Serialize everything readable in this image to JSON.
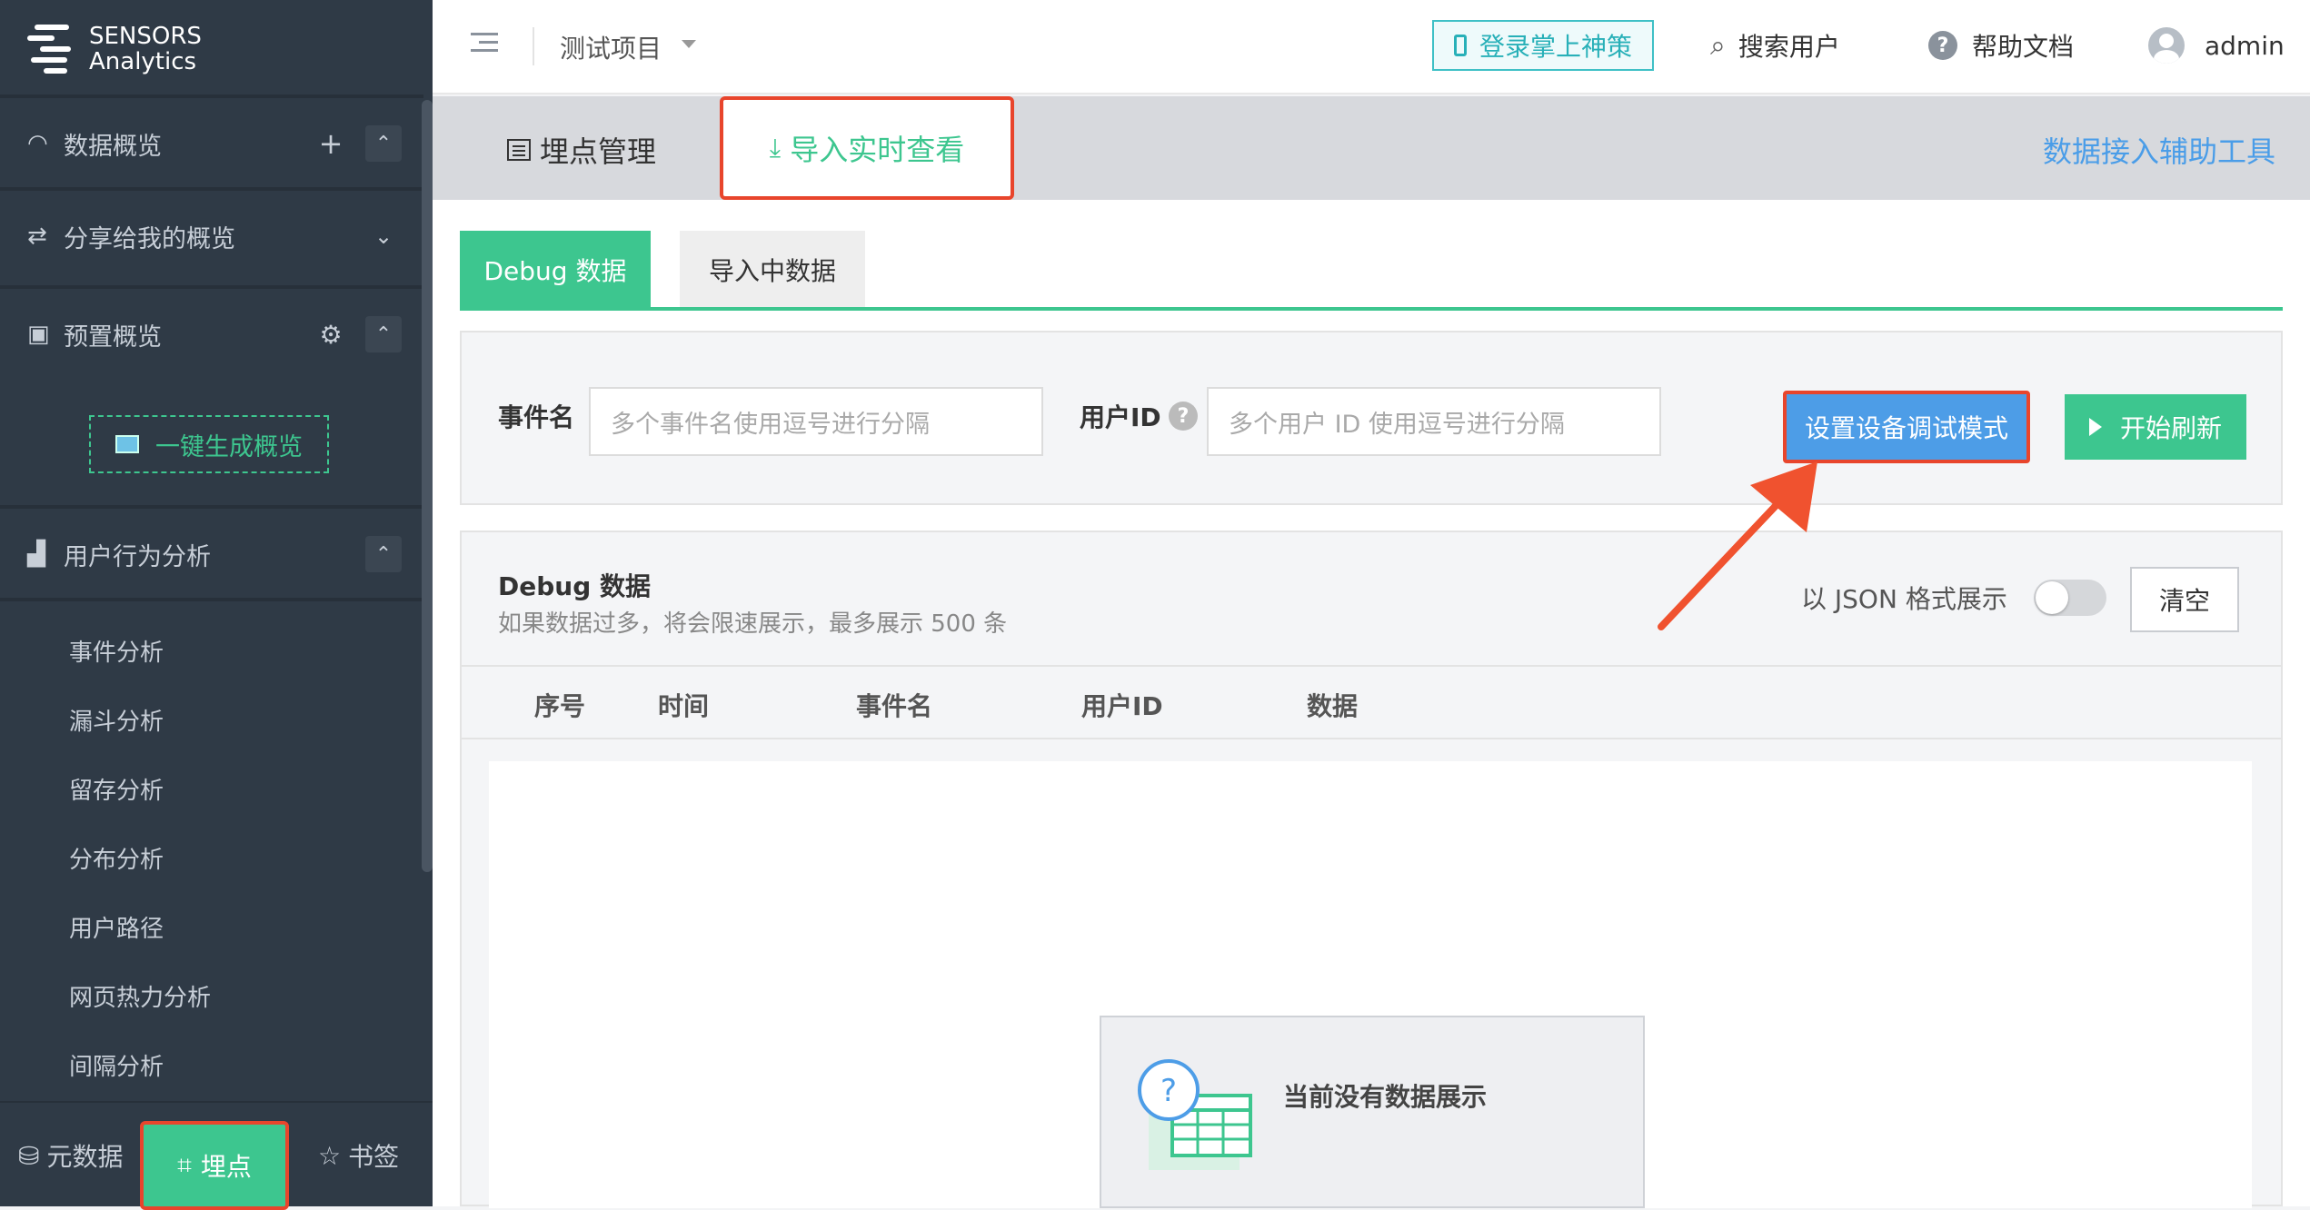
{
  "app": {
    "brand_line1": "SENSORS",
    "brand_line2": "Analytics"
  },
  "sidebar": {
    "sections": [
      {
        "label": "数据概览"
      },
      {
        "label": "分享给我的概览"
      },
      {
        "label": "预置概览"
      },
      {
        "label": "用户行为分析"
      }
    ],
    "generate_label": "一键生成概览",
    "items": [
      "事件分析",
      "漏斗分析",
      "留存分析",
      "分布分析",
      "用户路径",
      "网页热力分析",
      "间隔分析"
    ],
    "bottom": {
      "meta": "元数据",
      "tracking": "埋点",
      "bookmark": "书签"
    }
  },
  "topbar": {
    "project": "测试项目",
    "login_label": "登录掌上神策",
    "search_label": "搜索用户",
    "help_label": "帮助文档",
    "user": "admin"
  },
  "tabs": {
    "management": "埋点管理",
    "import": "导入实时查看",
    "tool": "数据接入辅助工具"
  },
  "subtabs": {
    "debug": "Debug 数据",
    "importing": "导入中数据"
  },
  "filter": {
    "event_label": "事件名",
    "event_placeholder": "多个事件名使用逗号进行分隔",
    "uid_label": "用户ID",
    "uid_placeholder": "多个用户 ID 使用逗号进行分隔",
    "set_device": "设置设备调试模式",
    "start_refresh": "开始刷新"
  },
  "debug_panel": {
    "title": "Debug 数据",
    "subtitle": "如果数据过多，将会限速展示，最多展示 500 条",
    "json_label": "以 JSON 格式展示",
    "clear": "清空",
    "columns": [
      "序号",
      "时间",
      "事件名",
      "用户ID",
      "数据"
    ],
    "empty": "当前没有数据展示"
  },
  "colors": {
    "sidebar_bg": "#2f3a46",
    "accent_green": "#3dc68f",
    "blue": "#4d9de7",
    "highlight_red": "#e8452c"
  }
}
